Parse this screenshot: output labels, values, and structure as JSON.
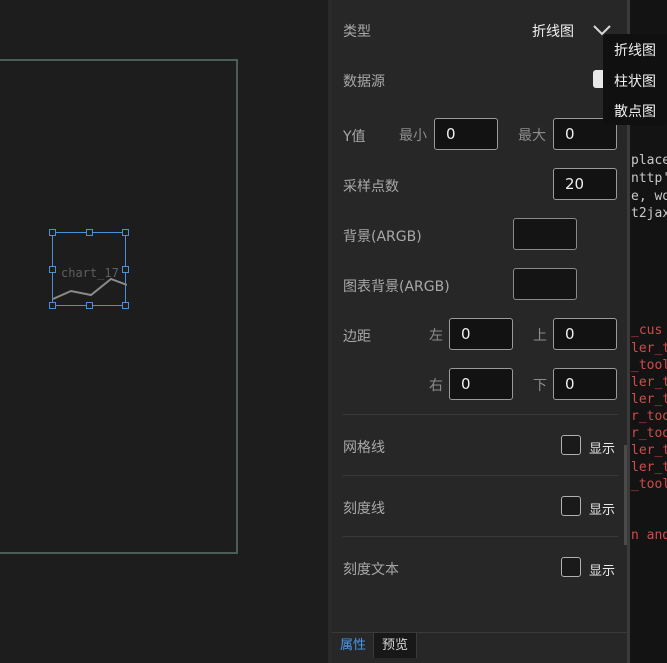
{
  "canvas": {
    "widget_name": "chart_17"
  },
  "props": {
    "type_label": "类型",
    "type_value": "折线图",
    "datasource_label": "数据源",
    "y_label": "Y值",
    "y_min_label": "最小",
    "y_min_value": "0",
    "y_max_label": "最大",
    "y_max_value": "0",
    "samples_label": "采样点数",
    "samples_value": "20",
    "bg_label": "背景(ARGB)",
    "chart_bg_label": "图表背景(ARGB)",
    "margin_label": "边距",
    "left_label": "左",
    "left_value": "0",
    "top_label": "上",
    "top_value": "0",
    "right_label": "右",
    "right_value": "0",
    "bottom_label": "下",
    "bottom_value": "0",
    "grid_label": "网格线",
    "tick_label": "刻度线",
    "ticktext_label": "刻度文本",
    "show_label": "显示"
  },
  "dropdown": {
    "options": [
      "折线图",
      "柱状图",
      "散点图"
    ]
  },
  "tabs": {
    "properties": "属性",
    "preview": "预览"
  },
  "code": {
    "lines": [
      {
        "text": "place",
        "color": "#c8c8c8"
      },
      {
        "text": "nttp'",
        "color": "#c8c8c8"
      },
      {
        "text": "e, wo",
        "color": "#c8c8c8"
      },
      {
        "text": "t2jax",
        "color": "#c8c8c8"
      },
      {
        "text": "_cus",
        "color": "#d24a4a"
      },
      {
        "text": "ler_t",
        "color": "#d24a4a"
      },
      {
        "text": "_tool",
        "color": "#d24a4a"
      },
      {
        "text": "ler_t",
        "color": "#d24a4a"
      },
      {
        "text": "ler_t",
        "color": "#d24a4a"
      },
      {
        "text": "r_too",
        "color": "#d24a4a"
      },
      {
        "text": "r_too",
        "color": "#d24a4a"
      },
      {
        "text": "ler_t",
        "color": "#d24a4a"
      },
      {
        "text": "ler_t",
        "color": "#d24a4a"
      },
      {
        "text": "_tool",
        "color": "#d24a4a"
      },
      {
        "text": "n and",
        "color": "#d24a4a"
      }
    ]
  },
  "colors": {
    "accent": "#4a9ae8",
    "selection": "#4a8fd8",
    "code_red": "#d24a4a"
  }
}
